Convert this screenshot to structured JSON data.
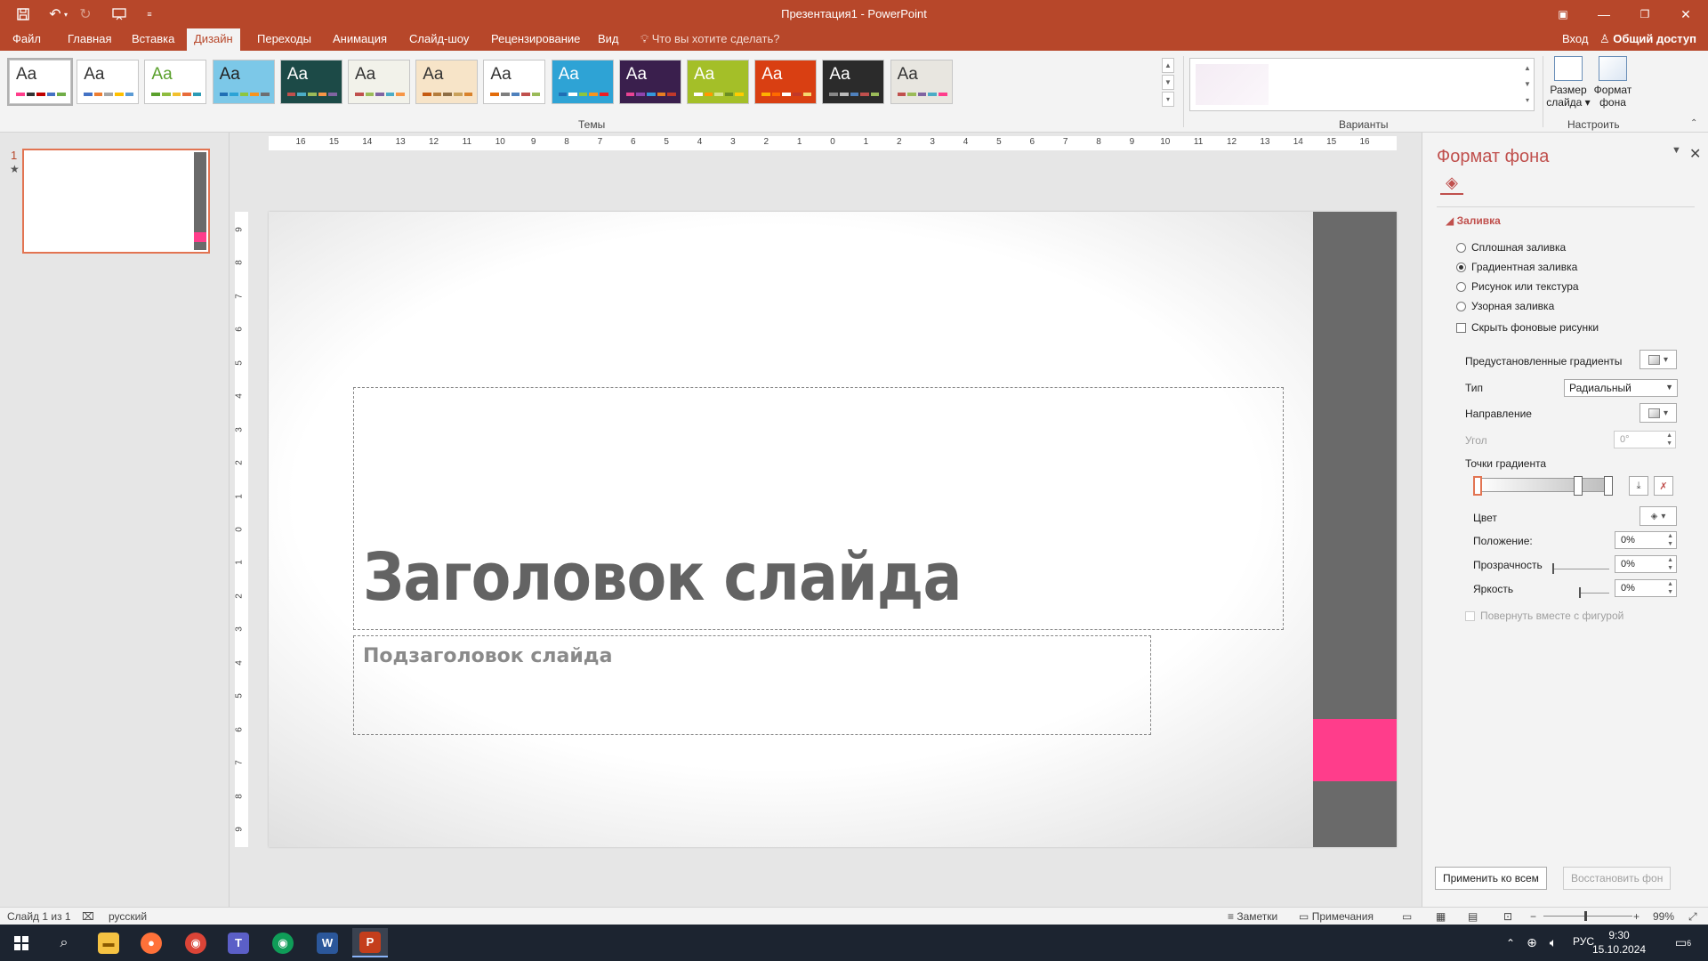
{
  "titlebar": {
    "title": "Презентация1 - PowerPoint",
    "quick_access": [
      "save-icon",
      "undo-icon",
      "redo-icon",
      "present-from-start-icon",
      "customize-qat-icon"
    ],
    "window_buttons": [
      "ribbon-display-options-icon",
      "minimize-icon",
      "restore-icon",
      "close-icon"
    ]
  },
  "tabs": [
    {
      "label": "Файл",
      "active": false
    },
    {
      "label": "Главная",
      "active": false
    },
    {
      "label": "Вставка",
      "active": false
    },
    {
      "label": "Дизайн",
      "active": true
    },
    {
      "label": "Переходы",
      "active": false
    },
    {
      "label": "Анимация",
      "active": false
    },
    {
      "label": "Слайд-шоу",
      "active": false
    },
    {
      "label": "Рецензирование",
      "active": false
    },
    {
      "label": "Вид",
      "active": false
    }
  ],
  "tell_me": "Что вы хотите сделать?",
  "signin": "Вход",
  "share": "Общий доступ",
  "ribbon": {
    "themes_label": "Темы",
    "variants_label": "Варианты",
    "customize_label": "Настроить",
    "theme_aa": "Aa",
    "slide_size": "Размер слайда",
    "format_background": "Формат фона",
    "themes": [
      {
        "bg": "#ffffff",
        "fg": "#333333",
        "colors": [
          "#ff3d8b",
          "#333333",
          "#c00000",
          "#4472c4",
          "#70ad47"
        ]
      },
      {
        "bg": "#ffffff",
        "fg": "#333333",
        "colors": [
          "#4472c4",
          "#ed7d31",
          "#a5a5a5",
          "#ffc000",
          "#5b9bd5"
        ]
      },
      {
        "bg": "#ffffff",
        "fg": "#5aa02c",
        "colors": [
          "#5aa02c",
          "#8fbc3f",
          "#f2c02e",
          "#e86c3a",
          "#2d9bb5"
        ]
      },
      {
        "bg": "#7cc8e8",
        "fg": "#222222",
        "colors": [
          "#1f6fb5",
          "#2ba3d6",
          "#8dc63f",
          "#f7941d",
          "#6d6e71"
        ]
      },
      {
        "bg": "#1c4a47",
        "fg": "#ffffff",
        "colors": [
          "#c0504d",
          "#4bacc6",
          "#9bbb59",
          "#f79646",
          "#8064a2"
        ]
      },
      {
        "bg": "#f2f2ea",
        "fg": "#333333",
        "colors": [
          "#c0504d",
          "#9bbb59",
          "#8064a2",
          "#4bacc6",
          "#f79646"
        ]
      },
      {
        "bg": "#f7e4c8",
        "fg": "#333333",
        "colors": [
          "#c55a11",
          "#b47c3c",
          "#8d6d45",
          "#c9a15b",
          "#d9822b"
        ]
      },
      {
        "bg": "#ffffff",
        "fg": "#333333",
        "colors": [
          "#e36c0a",
          "#7f7f7f",
          "#4f81bd",
          "#c0504d",
          "#9bbb59"
        ]
      },
      {
        "bg": "#2ea3d5",
        "fg": "#ffffff",
        "colors": [
          "#1f6fb5",
          "#ffffff",
          "#8dc63f",
          "#f7941d",
          "#ed1c24"
        ]
      },
      {
        "bg": "#3a1f4d",
        "fg": "#ffffff",
        "colors": [
          "#e84393",
          "#8e44ad",
          "#3498db",
          "#e67e22",
          "#c0392b"
        ]
      },
      {
        "bg": "#a4bf28",
        "fg": "#ffffff",
        "colors": [
          "#ffffff",
          "#ff9900",
          "#d6e48a",
          "#6b8e23",
          "#ffcc00"
        ]
      },
      {
        "bg": "#d93f12",
        "fg": "#ffffff",
        "colors": [
          "#ffb000",
          "#ff6a00",
          "#ffffff",
          "#c0392b",
          "#f5d76e"
        ]
      },
      {
        "bg": "#2b2b2b",
        "fg": "#ffffff",
        "colors": [
          "#888888",
          "#bbbbbb",
          "#4f81bd",
          "#c0504d",
          "#9bbb59"
        ]
      },
      {
        "bg": "#e8e6e0",
        "fg": "#333333",
        "colors": [
          "#c0504d",
          "#9bbb59",
          "#8064a2",
          "#4bacc6",
          "#ff3d8b"
        ]
      }
    ]
  },
  "thumbnail": {
    "number": "1",
    "star": "★"
  },
  "ruler": {
    "h_ticks": [
      "16",
      "15",
      "14",
      "13",
      "12",
      "11",
      "10",
      "9",
      "8",
      "7",
      "6",
      "5",
      "4",
      "3",
      "2",
      "1",
      "0",
      "1",
      "2",
      "3",
      "4",
      "5",
      "6",
      "7",
      "8",
      "9",
      "10",
      "11",
      "12",
      "13",
      "14",
      "15",
      "16"
    ],
    "v_ticks": [
      "9",
      "8",
      "7",
      "6",
      "5",
      "4",
      "3",
      "2",
      "1",
      "0",
      "1",
      "2",
      "3",
      "4",
      "5",
      "6",
      "7",
      "8",
      "9"
    ]
  },
  "slide": {
    "title": "Заголовок слайда",
    "subtitle": "Подзаголовок слайда",
    "accent_gray": "#6a6a6a",
    "accent_pink": "#ff3d8b"
  },
  "format_pane": {
    "title": "Формат фона",
    "section": "Заливка",
    "options": [
      {
        "label": "Сплошная заливка",
        "selected": false
      },
      {
        "label": "Градиентная заливка",
        "selected": true
      },
      {
        "label": "Рисунок или текстура",
        "selected": false
      },
      {
        "label": "Узорная заливка",
        "selected": false
      }
    ],
    "hide_bg": "Скрыть фоновые рисунки",
    "preset": "Предустановленные градиенты",
    "type_label": "Тип",
    "type_value": "Радиальный",
    "direction": "Направление",
    "angle_label": "Угол",
    "angle_value": "0°",
    "stops_label": "Точки градиента",
    "color_label": "Цвет",
    "position_label": "Положение:",
    "position_value": "0%",
    "transparency_label": "Прозрачность",
    "transparency_value": "0%",
    "brightness_label": "Яркость",
    "brightness_value": "0%",
    "rotate_label": "Повернуть вместе с фигурой",
    "apply_all": "Применить ко всем",
    "reset_bg": "Восстановить фон"
  },
  "status": {
    "slide_of": "Слайд 1 из 1",
    "language": "русский",
    "notes": "Заметки",
    "comments": "Примечания",
    "zoom": "99%"
  },
  "taskbar": {
    "lang": "РУС",
    "time": "9:30",
    "date": "15.10.2024",
    "notifications": "6"
  }
}
